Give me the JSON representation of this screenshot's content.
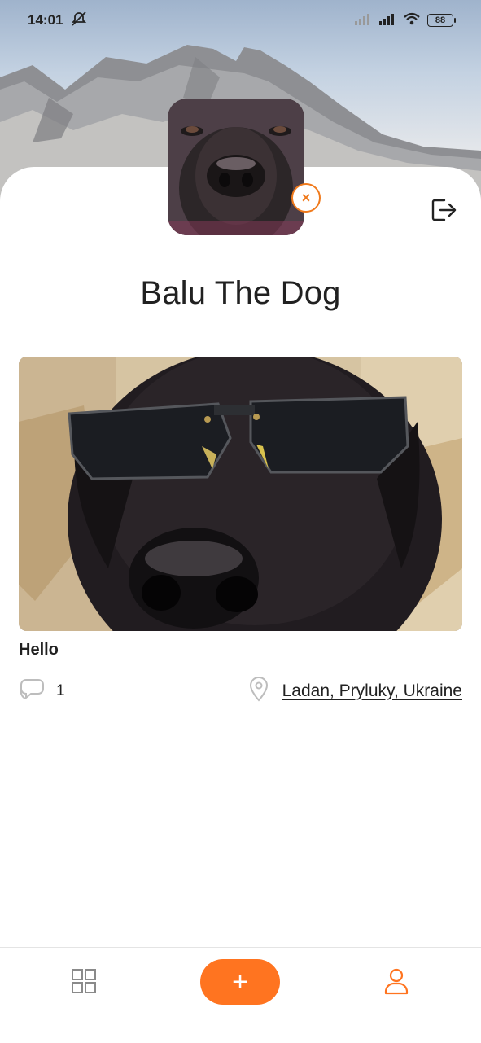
{
  "status_bar": {
    "time": "14:01",
    "battery": "88",
    "icons": [
      "alarm-off-icon",
      "signal-icon",
      "signal-icon",
      "wifi-icon",
      "battery-icon"
    ]
  },
  "profile": {
    "name": "Balu The Dog",
    "avatar_remove_label": "×",
    "logout_icon": "logout-icon"
  },
  "post": {
    "title": "Hello",
    "comments_count": "1",
    "location": "Ladan, Pryluky, Ukraine"
  },
  "bottom_nav": {
    "add_label": "+",
    "items": [
      "grid-icon",
      "add-icon",
      "user-icon"
    ]
  },
  "colors": {
    "accent": "#ff7420",
    "text": "#212121",
    "muted_icon": "#bdbdbd"
  }
}
